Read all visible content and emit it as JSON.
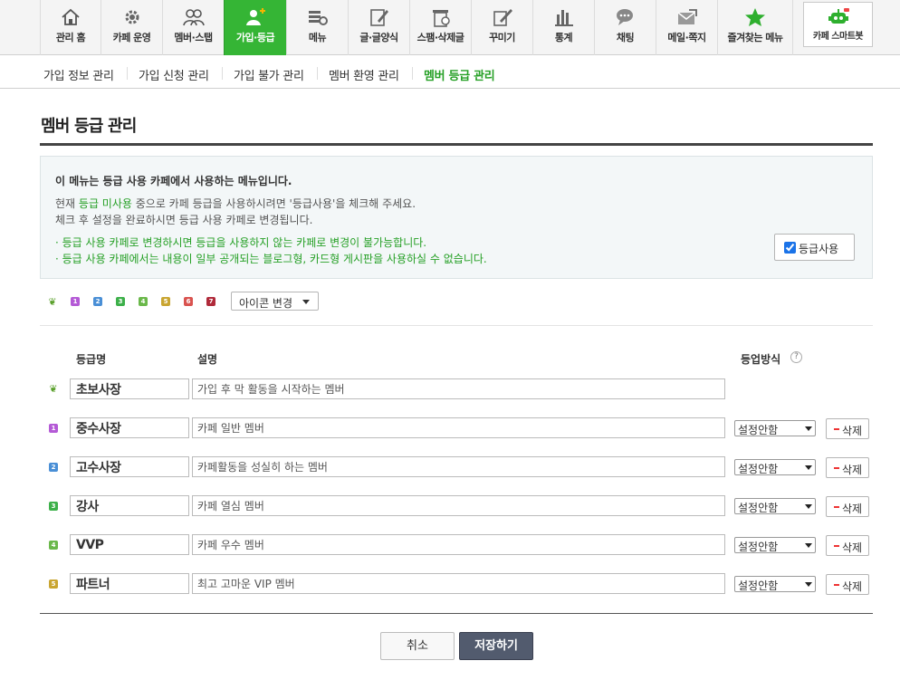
{
  "top_nav": {
    "items": [
      {
        "label": "관리 홈",
        "icon": "home-icon"
      },
      {
        "label": "카페 운영",
        "icon": "gear-icon"
      },
      {
        "label": "멤버·스탭",
        "icon": "members-icon"
      },
      {
        "label": "가입·등급",
        "icon": "member-add-icon"
      },
      {
        "label": "메뉴",
        "icon": "menu-gear-icon"
      },
      {
        "label": "글·글양식",
        "icon": "pencil-icon"
      },
      {
        "label": "스팸·삭제글",
        "icon": "trash-icon"
      },
      {
        "label": "꾸미기",
        "icon": "brush-icon"
      },
      {
        "label": "통계",
        "icon": "bar-chart-icon"
      },
      {
        "label": "채팅",
        "icon": "chat-icon"
      },
      {
        "label": "메일·쪽지",
        "icon": "mail-icon"
      },
      {
        "label": "즐겨찾는 메뉴",
        "icon": "star-icon"
      }
    ],
    "smart_label": "카페 스마트봇",
    "active_color": "#35b535"
  },
  "sub_nav": {
    "items": [
      "가입 정보 관리",
      "가입 신청 관리",
      "가입 불가 관리",
      "멤버 환영 관리",
      "멤버 등급 관리"
    ]
  },
  "page": {
    "title": "멤버 등급 관리"
  },
  "notice": {
    "heading": "이 메뉴는 등급 사용 카페에서 사용하는 메뉴입니다.",
    "line1_pre": "현재 ",
    "line1_hl": "등급 미사용",
    "line1_post": " 중으로 카페 등급을 사용하시려면 '등급사용'을 체크해 주세요.",
    "line2": "체크 후 설정을 완료하시면 등급 사용 카페로 변경됩니다.",
    "green1": "· 등급 사용 카페로 변경하시면 등급을 사용하지 않는 카페로 변경이 불가능합니다.",
    "green2": "· 등급 사용 카페에서는 내용이 일부 공개되는 블로그형, 카드형 게시판을 사용하실 수 없습니다.",
    "checkbox_label": "등급사용",
    "checked": true
  },
  "icon_row": {
    "change_label": "아이콘 변경",
    "icons": [
      {
        "name": "sprout-grade-icon",
        "glyph": "❦",
        "color": "#5aa02c"
      },
      {
        "name": "grade1-icon",
        "glyph": "1",
        "color": "#b45ad6"
      },
      {
        "name": "grade2-icon",
        "glyph": "2",
        "color": "#4a8fd6"
      },
      {
        "name": "grade3-icon",
        "glyph": "3",
        "color": "#3db04a"
      },
      {
        "name": "grade4-icon",
        "glyph": "4",
        "color": "#6ab84a"
      },
      {
        "name": "grade5-icon",
        "glyph": "5",
        "color": "#c9a531"
      },
      {
        "name": "grade6-icon",
        "glyph": "6",
        "color": "#d9534f"
      },
      {
        "name": "grade7-icon",
        "glyph": "7",
        "color": "#b02a3a"
      }
    ]
  },
  "table": {
    "col_name": "등급명",
    "col_desc": "설명",
    "col_method": "등업방식",
    "help": "?",
    "delete_label": "삭제",
    "rows": [
      {
        "icon": "❦",
        "color": "#5aa02c",
        "name": "초보사장",
        "desc": "가입 후 막 활동을 시작하는 멤버",
        "method": null
      },
      {
        "icon": "1",
        "color": "#b45ad6",
        "name": "중수사장",
        "desc": "카페 일반 멤버",
        "method": "설정안함"
      },
      {
        "icon": "2",
        "color": "#4a8fd6",
        "name": "고수사장",
        "desc": "카페활동을 성실히 하는 멤버",
        "method": "설정안함"
      },
      {
        "icon": "3",
        "color": "#3db04a",
        "name": "강사",
        "desc": "카페 열심 멤버",
        "method": "설정안함"
      },
      {
        "icon": "4",
        "color": "#6ab84a",
        "name": "VVP",
        "desc": "카페 우수 멤버",
        "method": "설정안함"
      },
      {
        "icon": "5",
        "color": "#c9a531",
        "name": "파트너",
        "desc": "최고 고마운 VIP 멤버",
        "method": "설정안함"
      }
    ]
  },
  "actions": {
    "cancel_label": "취소",
    "save_label": "저장하기"
  }
}
